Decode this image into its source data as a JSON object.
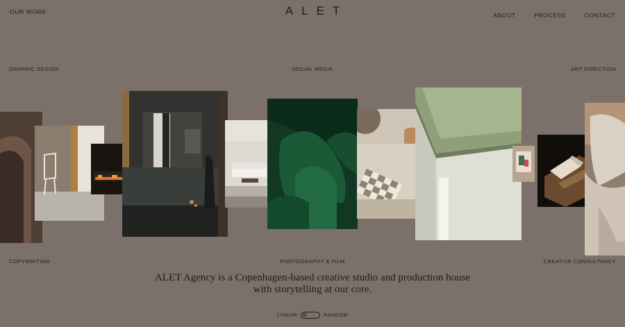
{
  "header": {
    "our_work": "OUR WORK",
    "logo": "ALET",
    "nav": [
      "ABOUT",
      "PROCESS",
      "CONTACT"
    ]
  },
  "services": {
    "graphic_design": "GRAPHIC DESIGN",
    "social_media": "SOCIAL MEDIA",
    "art_direction": "ART DIRECTION",
    "copywriting": "COPYWRITING",
    "photography_film": "PHOTOGRAPHY & FILM",
    "creative_consultancy": "CREATIVE CONSULTANCY"
  },
  "tagline": {
    "line1": "ALET Agency is a Copenhagen-based creative studio and production house",
    "line2": "with storytelling at our core."
  },
  "layout_toggle": {
    "left_label": "LINEAR",
    "right_label": "RANDOM",
    "selected": "LINEAR"
  },
  "colors": {
    "background": "#7b716a",
    "text": "#1f1c1a"
  }
}
